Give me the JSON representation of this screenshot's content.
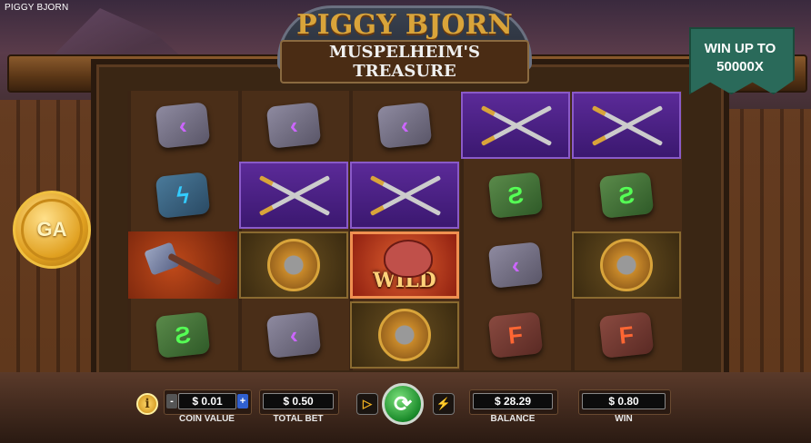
{
  "app": {
    "title": "PIGGY BJORN"
  },
  "logo": {
    "title": "PIGGY BJORN",
    "subtitle": "MUSPELHEIM'S TREASURE"
  },
  "promo": {
    "line1": "WIN UP TO",
    "line2": "50000X"
  },
  "brand": {
    "coin_text": "GA"
  },
  "reels": {
    "columns": 5,
    "rows": 4,
    "grid": [
      [
        "violet-rune",
        "violet-rune",
        "violet-rune",
        "swords",
        "swords"
      ],
      [
        "blue-rune",
        "swords",
        "swords",
        "green-rune",
        "green-rune"
      ],
      [
        "hammer",
        "shield",
        "wild",
        "violet-rune",
        "shield"
      ],
      [
        "green-rune",
        "violet-rune",
        "shield",
        "red-rune",
        "red-rune"
      ]
    ],
    "wild_label": "WILD"
  },
  "controls": {
    "info_label": "i",
    "coin_value": "$ 0.01",
    "coin_value_label": "COIN VALUE",
    "coin_minus": "-",
    "coin_plus": "+",
    "total_bet": "$ 0.50",
    "total_bet_label": "TOTAL BET",
    "autoplay_icon": "play-circle-icon",
    "spin_icon": "refresh-icon",
    "turbo_icon": "lightning-icon",
    "balance": "$ 28.29",
    "balance_label": "BALANCE",
    "win": "$ 0.80",
    "win_label": "WIN"
  },
  "colors": {
    "accent": "#d9a43a",
    "banner": "#2a6a5a",
    "spin": "#1a8a2a"
  }
}
